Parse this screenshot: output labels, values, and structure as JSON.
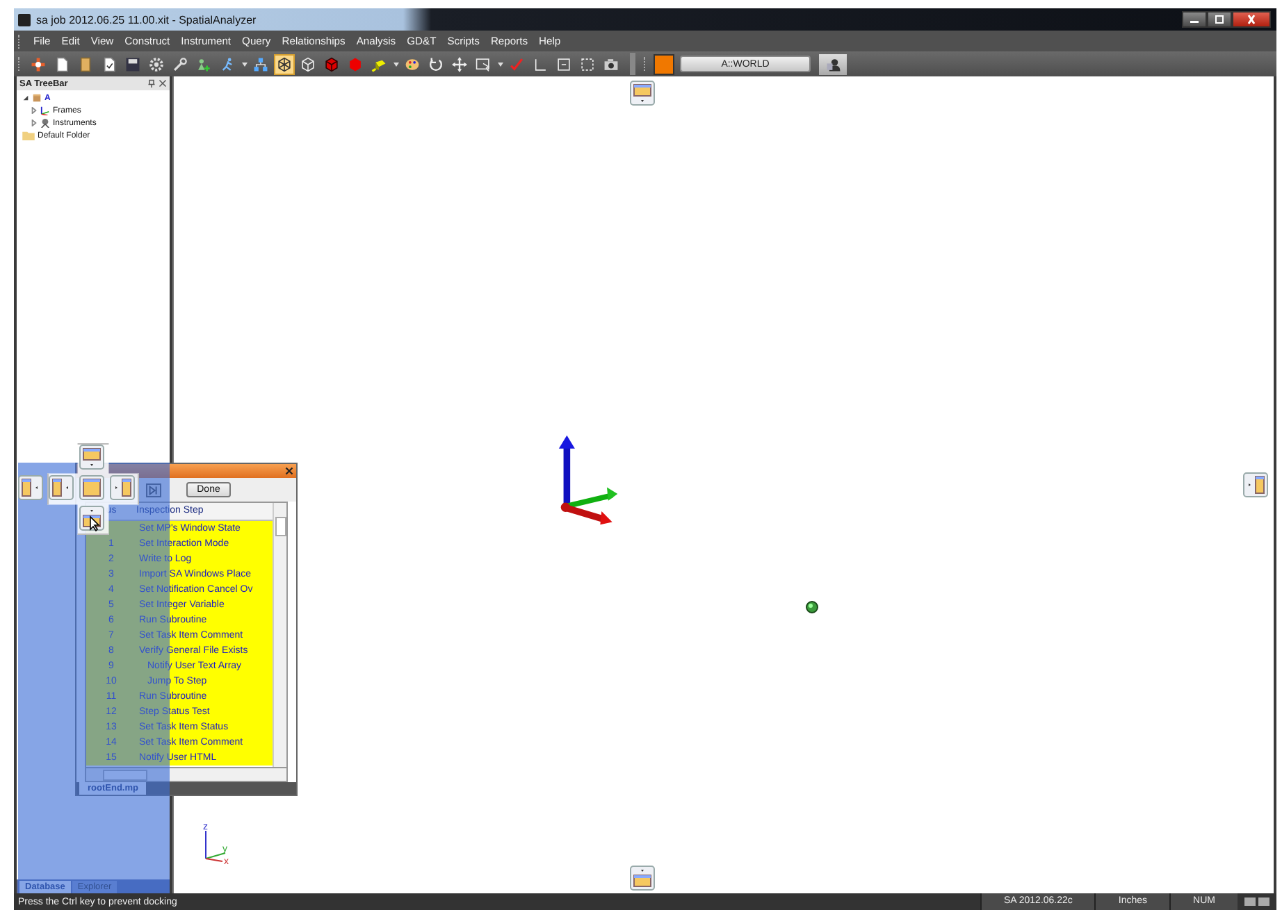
{
  "window": {
    "title": "sa job 2012.06.25 11.00.xit - SpatialAnalyzer"
  },
  "menu": [
    "File",
    "Edit",
    "View",
    "Construct",
    "Instrument",
    "Query",
    "Relationships",
    "Analysis",
    "GD&T",
    "Scripts",
    "Reports",
    "Help"
  ],
  "toolbar": [
    {
      "kind": "move",
      "selected": false
    },
    {
      "kind": "new",
      "selected": false
    },
    {
      "kind": "open",
      "selected": false
    },
    {
      "kind": "import",
      "selected": false
    },
    {
      "kind": "save",
      "selected": false
    },
    {
      "kind": "gear",
      "selected": false
    },
    {
      "kind": "wrench",
      "selected": false
    },
    {
      "kind": "adduser",
      "selected": false
    },
    {
      "kind": "runner",
      "selected": false
    },
    {
      "kind": "caret",
      "selected": false
    },
    {
      "kind": "hierarchy",
      "selected": false
    },
    {
      "kind": "wirecube",
      "selected": true
    },
    {
      "kind": "cube",
      "selected": false
    },
    {
      "kind": "redcube",
      "selected": false
    },
    {
      "kind": "redhex",
      "selected": false
    },
    {
      "kind": "yellowcube",
      "selected": false
    },
    {
      "kind": "caret",
      "selected": false
    },
    {
      "kind": "palette",
      "selected": false
    },
    {
      "kind": "rotate",
      "selected": false
    },
    {
      "kind": "pan",
      "selected": false
    },
    {
      "kind": "select",
      "selected": false
    },
    {
      "kind": "caret",
      "selected": false
    },
    {
      "kind": "check",
      "selected": false
    },
    {
      "kind": "axes",
      "selected": false
    },
    {
      "kind": "plugin",
      "selected": false
    },
    {
      "kind": "dashrect",
      "selected": false
    },
    {
      "kind": "camera",
      "selected": false
    }
  ],
  "frame_combo": {
    "color": "#f07800",
    "value": "A::WORLD"
  },
  "treebar": {
    "title": "SA TreeBar",
    "items": [
      {
        "label": "A",
        "kind": "job",
        "expanded": true,
        "children": [
          {
            "label": "Frames",
            "kind": "frames",
            "expanded": false
          },
          {
            "label": "Instruments",
            "kind": "instruments",
            "expanded": false
          }
        ]
      },
      {
        "label": "Default Folder",
        "kind": "folder"
      }
    ],
    "tabs": [
      {
        "label": "Database",
        "selected": true
      },
      {
        "label": "Explorer",
        "selected": false
      }
    ]
  },
  "dialog": {
    "done_button": "Done",
    "columns": [
      "us",
      "Inspection Step"
    ],
    "rows": [
      {
        "step": "",
        "name": "Set MP's Window State"
      },
      {
        "step": "1",
        "name": "Set Interaction Mode"
      },
      {
        "step": "2",
        "name": "Write to Log"
      },
      {
        "step": "3",
        "name": "Import SA Windows Place"
      },
      {
        "step": "4",
        "name": "Set Notification Cancel Ov"
      },
      {
        "step": "5",
        "name": "Set Integer Variable"
      },
      {
        "step": "6",
        "name": "Run Subroutine"
      },
      {
        "step": "7",
        "name": "Set Task Item Comment"
      },
      {
        "step": "8",
        "name": "Verify General File Exists",
        "children": [
          {
            "step": "9",
            "name": "Notify User Text Array"
          },
          {
            "step": "10",
            "name": "Jump To Step"
          }
        ]
      },
      {
        "step": "11",
        "name": "Run Subroutine"
      },
      {
        "step": "12",
        "name": "Step Status Test"
      },
      {
        "step": "13",
        "name": "Set Task Item Status"
      },
      {
        "step": "14",
        "name": "Set Task Item Comment"
      },
      {
        "step": "15",
        "name": "Notify User HTML"
      }
    ],
    "tab": "rootEnd.mp"
  },
  "axis_triad": {
    "labels": [
      "z",
      "y",
      "x"
    ]
  },
  "status_bar": {
    "message": "Press the Ctrl key to prevent docking",
    "panes": [
      "SA 2012.06.22c",
      "Inches",
      "NUM"
    ]
  }
}
